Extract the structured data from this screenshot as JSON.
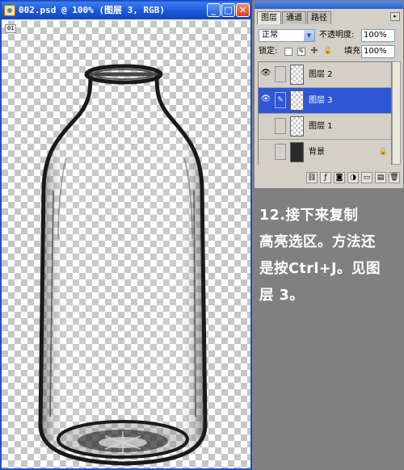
{
  "document": {
    "title": "002.psd @ 100% (图层 3, RGB)",
    "ruler_origin": "01",
    "window_buttons": {
      "minimize": "_",
      "maximize": "□",
      "close": "✕"
    }
  },
  "layers_panel": {
    "tabs": [
      {
        "label": "图层",
        "active": true
      },
      {
        "label": "通道",
        "active": false
      },
      {
        "label": "路径",
        "active": false
      }
    ],
    "blend_mode": "正常",
    "opacity_label": "不透明度:",
    "opacity_value": "100%",
    "lock_label": "锁定:",
    "fill_label": "填充:",
    "fill_value": "100%",
    "layers": [
      {
        "name": "图层 2",
        "visible": true,
        "selected": false,
        "thumb": "transparent"
      },
      {
        "name": "图层 3",
        "visible": true,
        "selected": true,
        "thumb": "transparent"
      },
      {
        "name": "图层 1",
        "visible": false,
        "selected": false,
        "thumb": "transparent"
      },
      {
        "name": "背景",
        "visible": false,
        "selected": false,
        "thumb": "dark",
        "locked": true
      }
    ],
    "toolbar_icons": [
      "link-icon",
      "layer-style-icon",
      "mask-icon",
      "adjustment-icon",
      "group-icon",
      "new-layer-icon",
      "trash-icon"
    ]
  },
  "tutorial_text": {
    "line1": "12.接下来复制",
    "line2": "高亮选区。方法还",
    "line3": "是按Ctrl+J。见图",
    "line4": "层 3。"
  },
  "colors": {
    "titlebar": "#1a56d8",
    "selected_layer": "#2f56d6",
    "background": "#808080"
  }
}
